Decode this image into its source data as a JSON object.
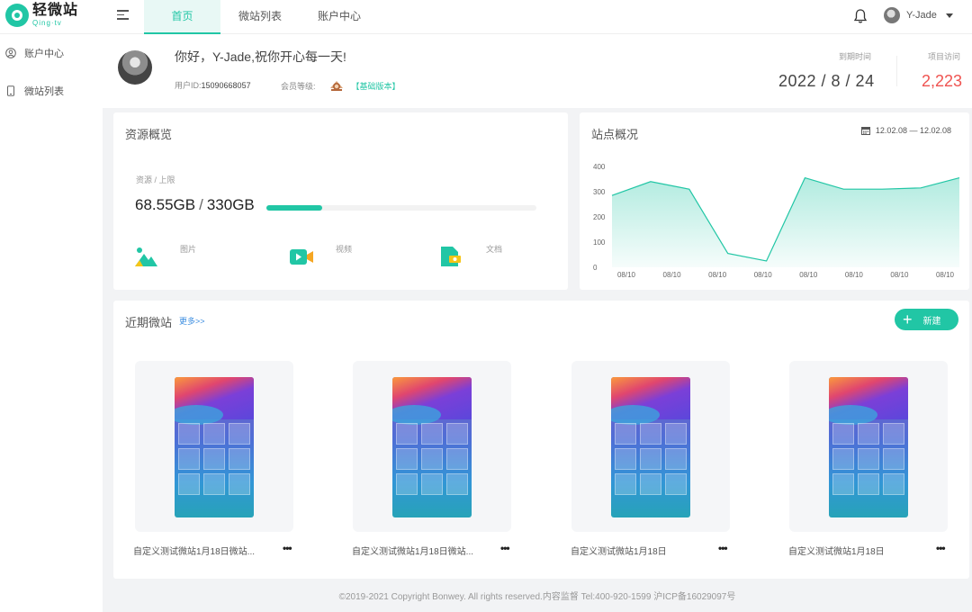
{
  "brand": {
    "name_cn": "轻微站",
    "name_en": "Qing·tv",
    "accent": "#21c6a5"
  },
  "nav": {
    "tabs": [
      {
        "label": "首页",
        "active": true
      },
      {
        "label": "微站列表",
        "active": false
      },
      {
        "label": "账户中心",
        "active": false
      }
    ]
  },
  "user": {
    "name": "Y-Jade"
  },
  "sidebar": {
    "items": [
      {
        "label": "账户中心",
        "icon": "user-circle-icon"
      },
      {
        "label": "微站列表",
        "icon": "phone-icon"
      }
    ]
  },
  "welcome": {
    "greeting": "你好，Y-Jade,祝你开心每一天!",
    "user_id_label": "用户ID:",
    "user_id": "15090668057",
    "level_label": "会员等级:",
    "level_tag": "【基础版本】",
    "expiry_label": "到期时间",
    "expiry_value": "2022 / 8 / 24",
    "visits_label": "项目访问",
    "visits_value": "2,223",
    "visits_color": "#ef5350"
  },
  "resources": {
    "title": "资源概览",
    "label": "资源 / 上限",
    "used": "68.55GB",
    "limit": "330GB",
    "usage_fraction": 0.2077,
    "items": [
      {
        "label": "图片",
        "icon": "image-icon"
      },
      {
        "label": "视频",
        "icon": "video-icon"
      },
      {
        "label": "文档",
        "icon": "document-icon"
      }
    ]
  },
  "site_overview": {
    "title": "站点概况",
    "date_range": "12.02.08 — 12.02.08"
  },
  "chart_data": {
    "type": "area",
    "title": "",
    "x": [
      "08/10",
      "08/10",
      "08/10",
      "08/10",
      "08/10",
      "08/10",
      "08/10",
      "08/10"
    ],
    "xlabel": "",
    "ylabel": "",
    "ylim": [
      0,
      400
    ],
    "yticks": [
      "0",
      "100",
      "200",
      "300",
      "400"
    ],
    "series": [
      {
        "values": [
          285,
          340,
          310,
          55,
          25,
          355,
          310,
          310,
          315,
          355
        ]
      }
    ],
    "color": "#21c6a5",
    "grid": false
  },
  "recent": {
    "title": "近期微站",
    "more_label": "更多>>",
    "new_label": "新建",
    "sites": [
      {
        "name": "自定义测试微站1月18日微站..."
      },
      {
        "name": "自定义测试微站1月18日微站..."
      },
      {
        "name": "自定义测试微站1月18日"
      },
      {
        "name": "自定义测试微站1月18日"
      }
    ],
    "menu_label": "•••"
  },
  "footer": {
    "text": "©2019-2021 Copyright Bonwey. All rights reserved.内容监督 Tel:400-920-1599 沪ICP备16029097号"
  }
}
